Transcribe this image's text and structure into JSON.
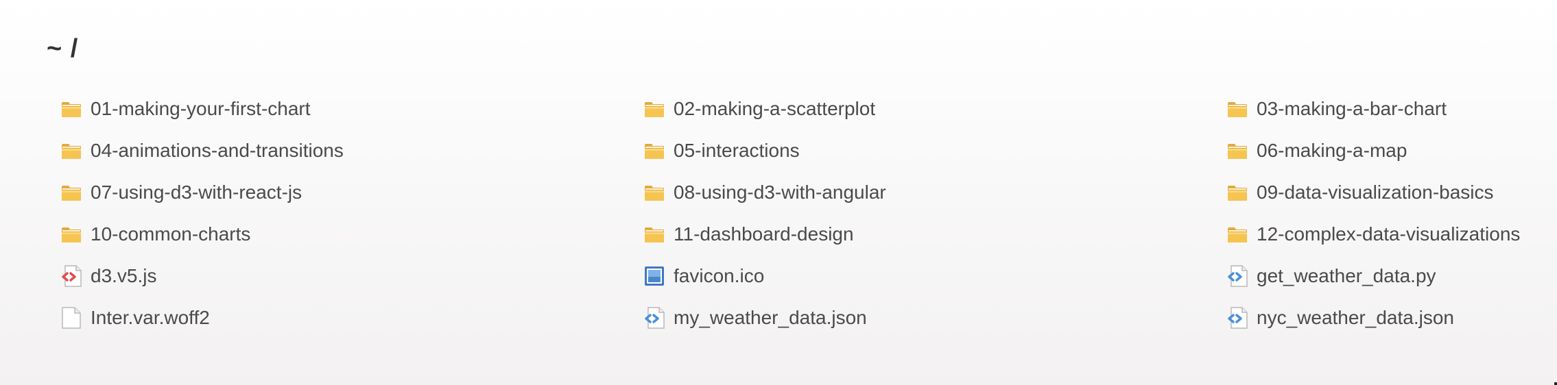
{
  "path": "~ /",
  "files": [
    {
      "name": "01-making-your-first-chart",
      "icon": "folder-icon"
    },
    {
      "name": "02-making-a-scatterplot",
      "icon": "folder-icon"
    },
    {
      "name": "03-making-a-bar-chart",
      "icon": "folder-icon"
    },
    {
      "name": "04-animations-and-transitions",
      "icon": "folder-icon"
    },
    {
      "name": "05-interactions",
      "icon": "folder-icon"
    },
    {
      "name": "06-making-a-map",
      "icon": "folder-icon"
    },
    {
      "name": "07-using-d3-with-react-js",
      "icon": "folder-icon"
    },
    {
      "name": "08-using-d3-with-angular",
      "icon": "folder-icon"
    },
    {
      "name": "09-data-visualization-basics",
      "icon": "folder-icon"
    },
    {
      "name": "10-common-charts",
      "icon": "folder-icon"
    },
    {
      "name": "11-dashboard-design",
      "icon": "folder-icon"
    },
    {
      "name": "12-complex-data-visualizations",
      "icon": "folder-icon"
    },
    {
      "name": "d3.v5.js",
      "icon": "code-file-red-icon"
    },
    {
      "name": "favicon.ico",
      "icon": "image-file-icon"
    },
    {
      "name": "get_weather_data.py",
      "icon": "code-file-blue-icon"
    },
    {
      "name": "Inter.var.woff2",
      "icon": "blank-file-icon"
    },
    {
      "name": "my_weather_data.json",
      "icon": "code-file-blue-icon"
    },
    {
      "name": "nyc_weather_data.json",
      "icon": "code-file-blue-icon"
    }
  ],
  "colors": {
    "folder": "#f5c451",
    "code_red": "#e04e4e",
    "code_blue": "#4a90d9",
    "image": "#3f78c4"
  }
}
